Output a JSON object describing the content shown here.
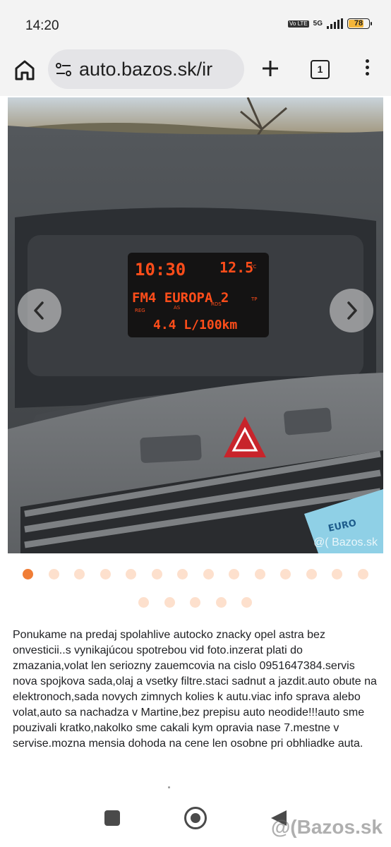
{
  "status_bar": {
    "time": "14:20",
    "volte": "Vo LTE",
    "network": "5G",
    "battery": "78",
    "battery_level": 0.78
  },
  "browser": {
    "url": "auto.bazos.sk/ir",
    "tab_count": "1"
  },
  "photo": {
    "clock": "10:30",
    "temperature": "12.5",
    "temperature_unit": "°C",
    "station": "FM4 EUROPA 2",
    "consumption": "4.4 L/100km",
    "flag_reg": "REG",
    "flag_as": "AS",
    "flag_rds": "RDS",
    "flag_tp": "TP",
    "banknote_text": "EURO",
    "watermark": "@( Bazos.sk"
  },
  "gallery": {
    "total": 19,
    "active_index": 0
  },
  "description": "Ponukame na predaj spolahlive autocko znacky opel astra bez onvesticii..s vynikajúcou spotrebou vid foto.inzerat plati do zmazania,volat len seriozny zauemcovia na cislo 0951647384.servis nova spojkova sada,olaj a vsetky filtre.staci sadnut a jazdit.auto obute na elektronoch,sada novych zimnych kolies k autu.viac info sprava alebo volat,auto sa nachadza v Martine,bez prepisu auto neodide!!!auto sme pouzivali kratko,nakolko sme cakali kym opravia nase 7.mestne v servise.mozna mensia dohoda na cene len osobne pri obhliadke auta.",
  "footer_watermark": "@(Bazos.sk",
  "colors": {
    "accent": "#f07d36",
    "dot_inactive": "#fde0cd",
    "display_text": "#ff4d1a"
  }
}
